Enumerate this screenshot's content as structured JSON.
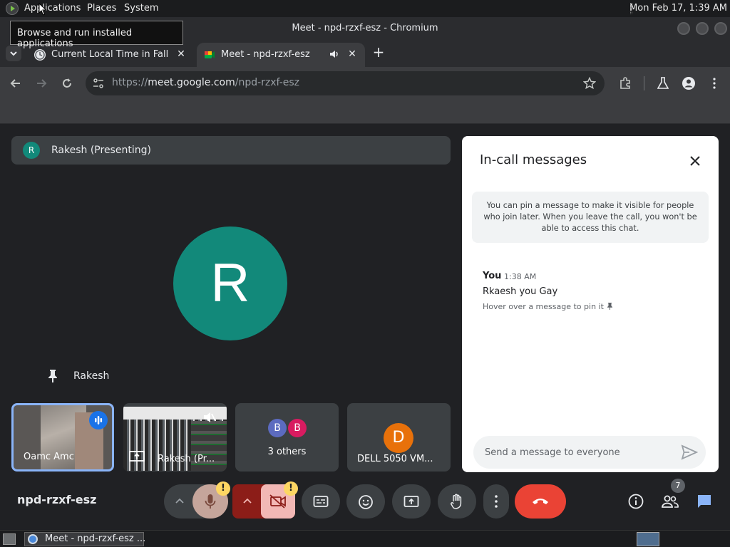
{
  "panel": {
    "menus": [
      "Applications",
      "Places",
      "System"
    ],
    "clock": "Mon Feb 17,  1:39 AM",
    "tooltip": "Browse and run installed applications"
  },
  "window": {
    "title": "Meet - npd-rzxf-esz - Chromium"
  },
  "tabs": [
    {
      "label": "Current Local Time in Fall Ri",
      "favicon": "clock-favicon"
    },
    {
      "label": "Meet - npd-rzxf-esz",
      "favicon": "meet-favicon",
      "audio": true
    }
  ],
  "omnibox": {
    "url_prefix": "https://",
    "url_host": "meet.google.com",
    "url_path": "/npd-rzxf-esz"
  },
  "meet": {
    "presenting": {
      "initial": "R",
      "label": "Rakesh (Presenting)"
    },
    "main_avatar_initial": "R",
    "main_name": "Rakesh",
    "tiles": [
      {
        "name": "Oamc Amc"
      },
      {
        "name": "Rakesh (Pr..."
      },
      {
        "name": "3 others",
        "initials": [
          "B",
          "B"
        ]
      },
      {
        "name": "DELL 5050 VM...",
        "initial": "D"
      }
    ],
    "meeting_code": "npd-rzxf-esz",
    "people_count": "7",
    "warn_mark": "!"
  },
  "chat": {
    "title": "In-call messages",
    "info": "You can pin a message to make it visible for people who join later. When you leave the call, you won't be able to access this chat.",
    "message": {
      "sender": "You",
      "time": "1:38 AM",
      "text": "Rkaesh you Gay",
      "hint": "Hover over a message to pin it"
    },
    "input_placeholder": "Send a message to everyone"
  },
  "taskbar": {
    "task_label": "Meet - npd-rzxf-esz ..."
  },
  "colors": {
    "meet_teal": "#12897a",
    "end_call": "#ea4335",
    "chat_icon": "#8ab4f8",
    "warn": "#fdd663"
  }
}
